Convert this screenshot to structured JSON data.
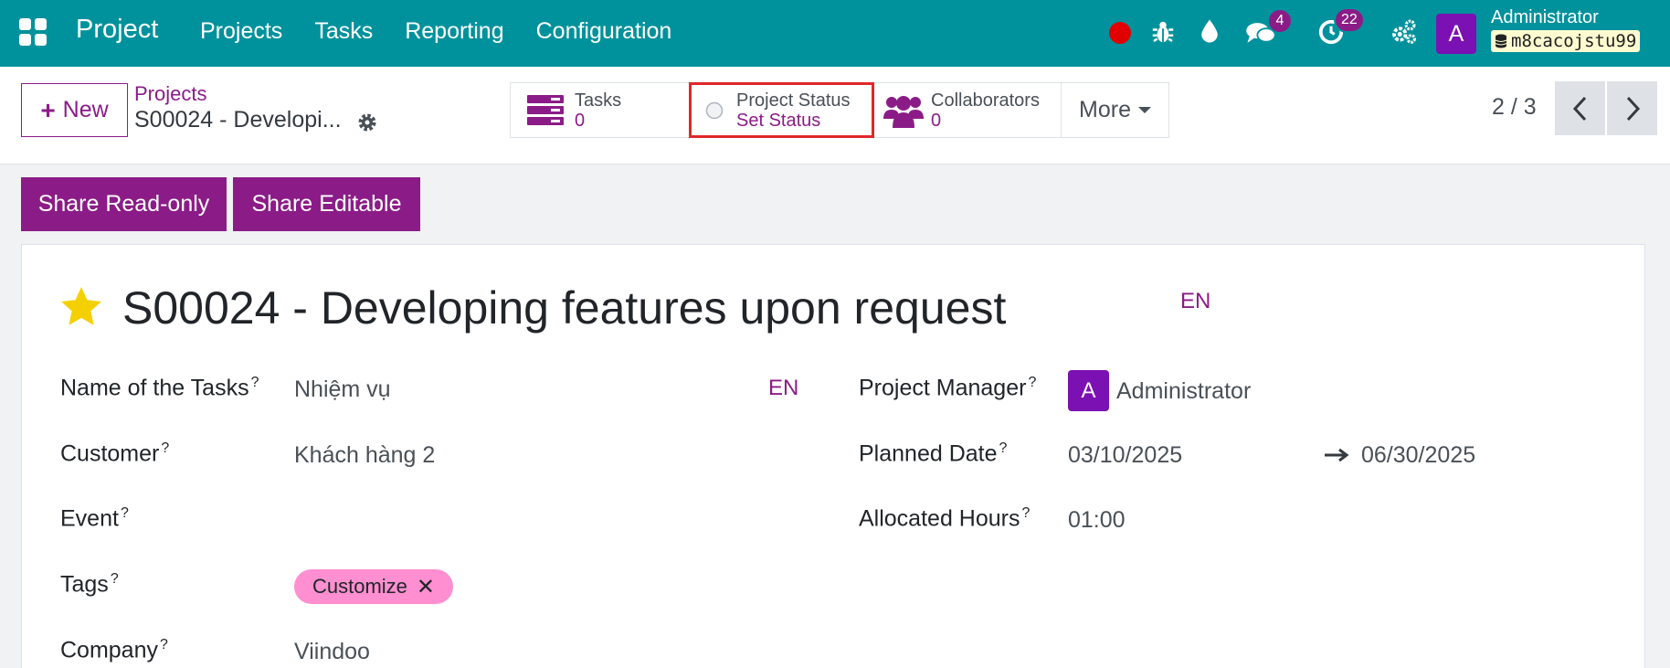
{
  "navbar": {
    "brand": "Project",
    "menu": [
      "Projects",
      "Tasks",
      "Reporting",
      "Configuration"
    ],
    "messages_count": "4",
    "activities_count": "22",
    "user_initial": "A",
    "user_name": "Administrator",
    "db_name": "m8cacojstu99",
    "colors": {
      "bar": "#00929c",
      "badge": "#8b1c87",
      "recording": "#e00000"
    }
  },
  "control": {
    "new_label": "New",
    "breadcrumb_parent": "Projects",
    "breadcrumb_current": "S00024 - Developi...",
    "smart_buttons": {
      "tasks": {
        "label": "Tasks",
        "value": "0"
      },
      "status": {
        "label": "Project Status",
        "value": "Set Status"
      },
      "collaborators": {
        "label": "Collaborators",
        "value": "0"
      },
      "more": "More"
    },
    "pager": "2 / 3"
  },
  "actions": {
    "share_readonly": "Share Read-only",
    "share_editable": "Share Editable"
  },
  "form": {
    "title": "S00024 - Developing features upon request",
    "lang": "EN",
    "fields": {
      "tasks_name": {
        "label": "Name of the Tasks",
        "value": "Nhiệm vụ"
      },
      "customer": {
        "label": "Customer",
        "value": "Khách hàng 2"
      },
      "event": {
        "label": "Event",
        "value": ""
      },
      "tags": {
        "label": "Tags",
        "value": "Customize"
      },
      "company": {
        "label": "Company",
        "value": "Viindoo"
      },
      "manager": {
        "label": "Project Manager",
        "value": "Administrator",
        "initial": "A"
      },
      "planned": {
        "label": "Planned Date",
        "start": "03/10/2025",
        "end": "06/30/2025"
      },
      "hours": {
        "label": "Allocated Hours",
        "value": "01:00"
      }
    },
    "help_mark": "?"
  }
}
